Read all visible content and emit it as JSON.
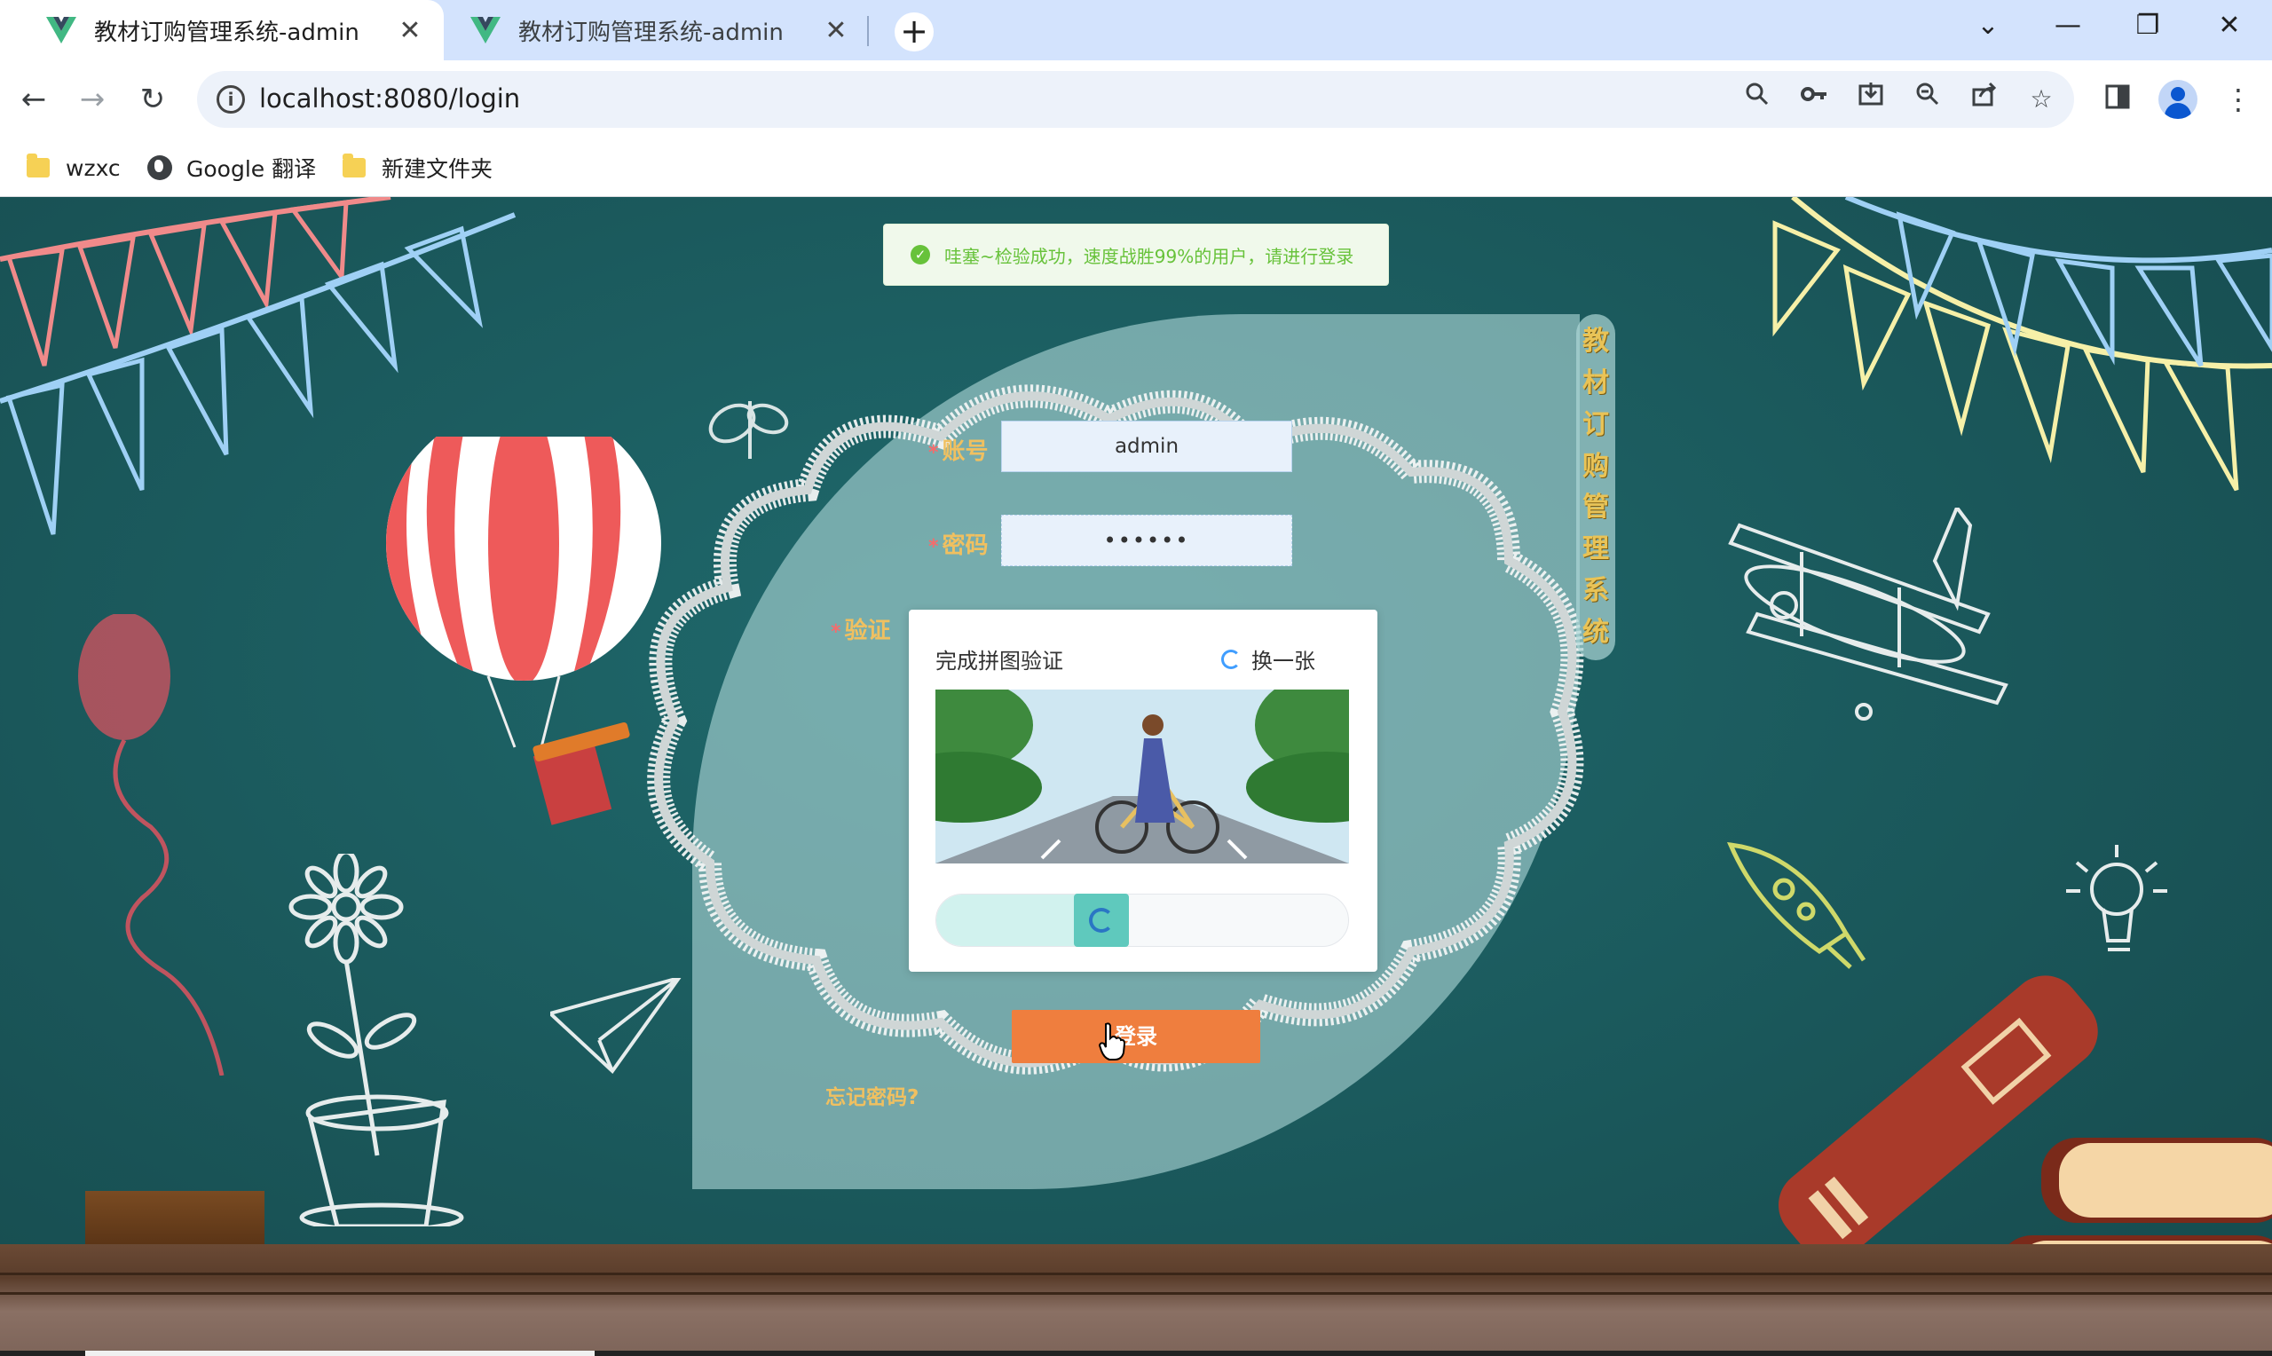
{
  "browser": {
    "tabs": [
      {
        "title": "教材订购管理系统-admin",
        "close": "✕"
      },
      {
        "title": "教材订购管理系统-admin",
        "close": "✕"
      }
    ],
    "new_tab": "+",
    "window_controls": {
      "dropdown": "⌄",
      "minimize": "—",
      "restore": "❐",
      "close": "✕"
    },
    "url": "localhost:8080/login",
    "bookmarks": [
      {
        "label": "wzxc",
        "icon": "folder-icon"
      },
      {
        "label": "Google 翻译",
        "icon": "globe-icon"
      },
      {
        "label": "新建文件夹",
        "icon": "folder-icon"
      }
    ]
  },
  "toast": {
    "message": "哇塞~检验成功，速度战胜99%的用户，请进行登录"
  },
  "login": {
    "system_title_chars": [
      "教",
      "材",
      "订",
      "购",
      "管",
      "理",
      "系",
      "统"
    ],
    "account_label": "账号",
    "account_value": "admin",
    "password_label": "密码",
    "password_value": "••••••",
    "verify_label": "验证",
    "required_mark": "*",
    "captcha_title": "完成拼图验证",
    "captcha_refresh": "换一张",
    "slider_progress": 0.34,
    "login_button": "登录",
    "forgot_password": "忘记密码?"
  },
  "colors": {
    "background": "#1e5d60",
    "accent_orange": "#ef7e3e",
    "label_gold": "#f0c060",
    "success_green": "#67c23a",
    "slider_teal": "#5fc9bd"
  }
}
